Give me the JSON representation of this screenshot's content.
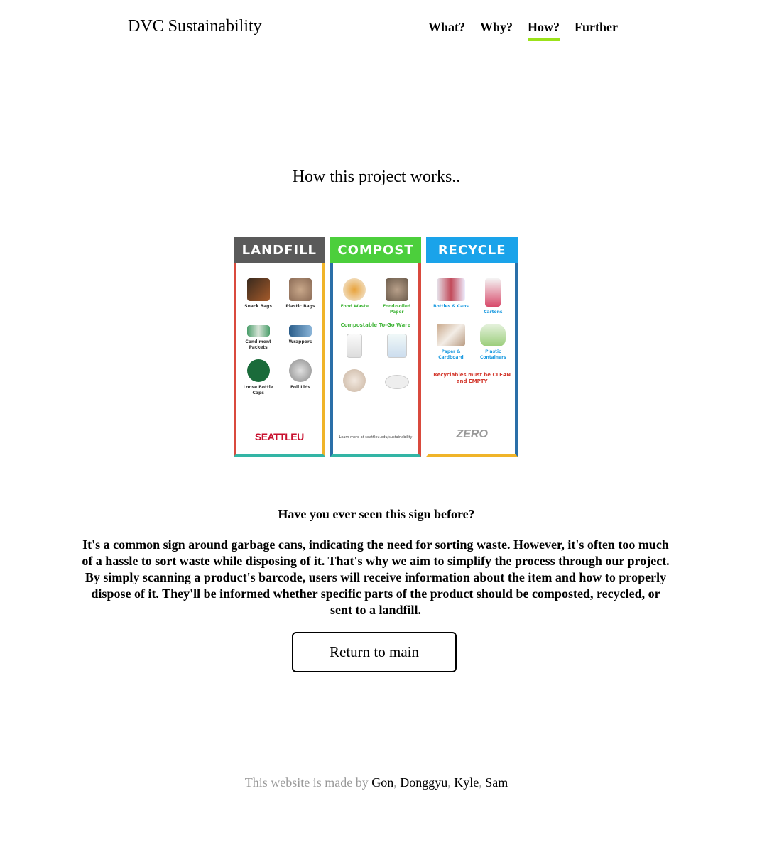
{
  "header": {
    "brand": "DVC Sustainability",
    "nav": [
      {
        "label": "What?",
        "active": false
      },
      {
        "label": "Why?",
        "active": false
      },
      {
        "label": "How?",
        "active": true
      },
      {
        "label": "Further",
        "active": false
      }
    ],
    "active_color": "#9be21a"
  },
  "main": {
    "heading": "How this project works..",
    "sign": {
      "landfill": {
        "title": "LANDFILL",
        "color": "#5a5a5a",
        "items": [
          "Snack Bags",
          "Plastic Bags",
          "Condiment Packets",
          "Wrappers",
          "Loose Bottle Caps",
          "Foil Lids"
        ],
        "logo": "SEATTLEU"
      },
      "compost": {
        "title": "COMPOST",
        "color": "#4ccf3c",
        "items": [
          "Food Waste",
          "Food-soiled Paper"
        ],
        "subheading": "Compostable To-Go Ware",
        "footer": "Learn more at seattleu.edu/sustainability"
      },
      "recycle": {
        "title": "RECYCLE",
        "color": "#1aa3ea",
        "items": [
          "Bottles & Cans",
          "Cartons",
          "Paper & Cardboard",
          "Plastic Containers"
        ],
        "note": "Recyclables must be CLEAN and EMPTY",
        "logo": "ZERO"
      }
    },
    "question": "Have you ever seen this sign before?",
    "paragraph": "It's a common sign around garbage cans, indicating the need for sorting waste. However, it's often too much of a hassle to sort waste while disposing of it. That's why we aim to simplify the process through our project. By simply scanning a product's barcode, users will receive information about the item and how to properly dispose of it. They'll be informed whether specific parts of the product should be composted, recycled, or sent to a landfill.",
    "button": "Return to main"
  },
  "footer": {
    "prefix": "This website is made by ",
    "authors": [
      "Gon",
      "Donggyu",
      "Kyle",
      "Sam"
    ],
    "separator": ", "
  }
}
